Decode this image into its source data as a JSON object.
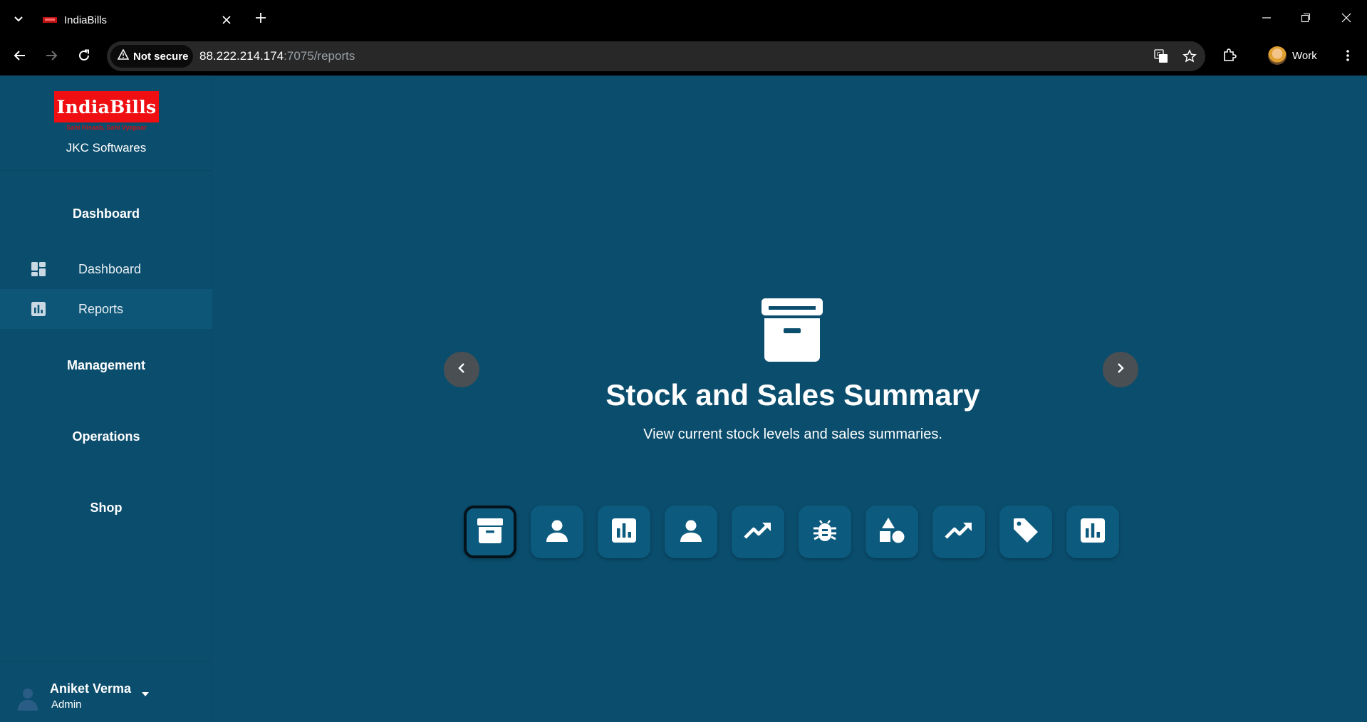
{
  "browser": {
    "tab_title": "IndiaBills",
    "security_label": "Not secure",
    "url_host": "88.222.214.174",
    "url_rest": ":7075/reports",
    "profile_name": "Work",
    "icons": [
      "tab-list-icon",
      "close-icon",
      "plus-icon",
      "minimize-icon",
      "restore-icon",
      "close-window-icon",
      "back-icon",
      "forward-icon",
      "reload-icon",
      "warning-icon",
      "translate-icon",
      "star-icon",
      "extensions-icon",
      "menu-icon"
    ]
  },
  "sidebar": {
    "logo_text": "IndiaBills",
    "logo_tagline": "Sahi Hisaab, Sahi Vyapaar",
    "company": "JKC Softwares",
    "sections": {
      "dashboard": "Dashboard",
      "management": "Management",
      "operations": "Operations",
      "shop": "Shop"
    },
    "items": [
      {
        "label": "Dashboard",
        "icon": "dashboard-icon",
        "active": false
      },
      {
        "label": "Reports",
        "icon": "bar-chart-icon",
        "active": true
      }
    ],
    "user": {
      "name": "Aniket Verma",
      "role": "Admin"
    }
  },
  "main": {
    "title": "Stock and Sales Summary",
    "description": "View current stock levels and sales summaries.",
    "hero_icon": "archive-icon",
    "report_buttons": [
      {
        "icon": "archive-icon",
        "selected": true
      },
      {
        "icon": "person-icon",
        "selected": false
      },
      {
        "icon": "bar-chart-icon",
        "selected": false
      },
      {
        "icon": "person-icon",
        "selected": false
      },
      {
        "icon": "trending-up-icon",
        "selected": false
      },
      {
        "icon": "bug-icon",
        "selected": false
      },
      {
        "icon": "category-shapes-icon",
        "selected": false
      },
      {
        "icon": "trending-up-icon",
        "selected": false
      },
      {
        "icon": "tag-icon",
        "selected": false
      },
      {
        "icon": "bar-chart-icon",
        "selected": false
      }
    ]
  },
  "colors": {
    "app_background": "#0b4d6d",
    "active_nav": "#0d5677",
    "logo_red": "#ef0f12",
    "button_background": "#0c5a7d",
    "arrow_button": "#4a4f53"
  }
}
